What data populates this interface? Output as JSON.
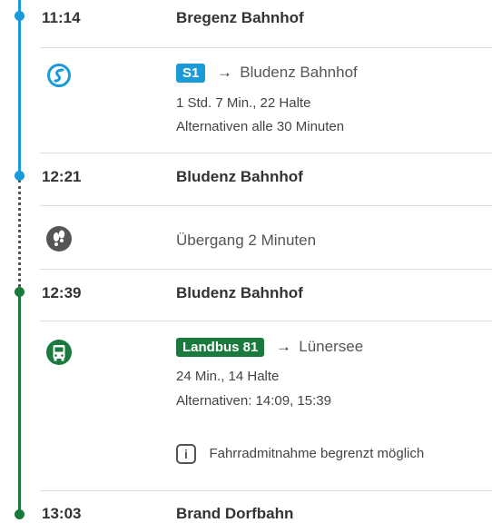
{
  "colors": {
    "s_bahn_blue": "#1a9ad8",
    "bus_green": "#1a7a3e",
    "walk_gray": "#555555"
  },
  "stops": [
    {
      "time": "11:14",
      "station": "Bregenz Bahnhof"
    },
    {
      "time": "12:21",
      "station": "Bludenz Bahnhof"
    },
    {
      "time": "12:39",
      "station": "Bludenz Bahnhof"
    },
    {
      "time": "13:03",
      "station": "Brand Dorfbahn"
    }
  ],
  "legs": [
    {
      "icon": "s-bahn-icon",
      "line": "S1",
      "arrow": "→",
      "destination": "Bludenz Bahnhof",
      "duration": "1 Std. 7 Min., 22 Halte",
      "alternatives": "Alternativen alle 30 Minuten"
    },
    {
      "icon": "walking-icon",
      "transfer": "Übergang 2 Minuten"
    },
    {
      "icon": "bus-icon",
      "line": "Landbus 81",
      "arrow": "→",
      "destination": "Lünersee",
      "duration": "24 Min., 14 Halte",
      "alternatives": "Alternativen: 14:09, 15:39",
      "info_symbol": "i",
      "info": "Fahrradmitnahme begrenzt möglich"
    }
  ]
}
